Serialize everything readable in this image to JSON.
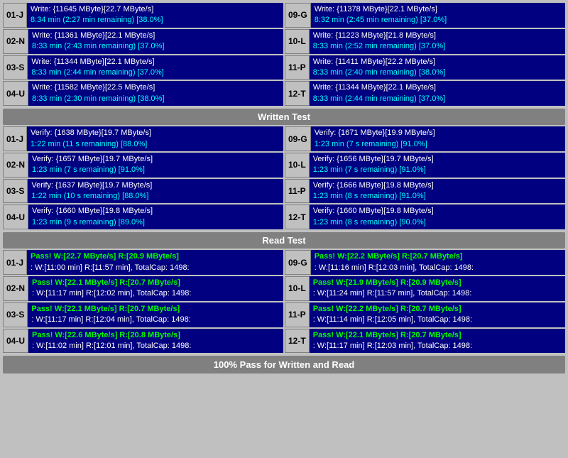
{
  "sections": {
    "write_test": {
      "label": "Written Test",
      "rows": [
        {
          "left": {
            "id": "01-J",
            "line1": "Write: {11645 MByte}[22.7 MByte/s]",
            "line2": "8:34 min (2:27 min remaining)  [38.0%]"
          },
          "right": {
            "id": "09-G",
            "line1": "Write: {11378 MByte}[22.1 MByte/s]",
            "line2": "8:32 min (2:45 min remaining)  [37.0%]"
          }
        },
        {
          "left": {
            "id": "02-N",
            "line1": "Write: {11361 MByte}[22.1 MByte/s]",
            "line2": "8:33 min (2:43 min remaining)  [37.0%]"
          },
          "right": {
            "id": "10-L",
            "line1": "Write: {11223 MByte}[21.8 MByte/s]",
            "line2": "8:33 min (2:52 min remaining)  [37.0%]"
          }
        },
        {
          "left": {
            "id": "03-S",
            "line1": "Write: {11344 MByte}[22.1 MByte/s]",
            "line2": "8:33 min (2:44 min remaining)  [37.0%]"
          },
          "right": {
            "id": "11-P",
            "line1": "Write: {11411 MByte}[22.2 MByte/s]",
            "line2": "8:33 min (2:40 min remaining)  [38.0%]"
          }
        },
        {
          "left": {
            "id": "04-U",
            "line1": "Write: {11582 MByte}[22.5 MByte/s]",
            "line2": "8:33 min (2:30 min remaining)  [38.0%]"
          },
          "right": {
            "id": "12-T",
            "line1": "Write: {11344 MByte}[22.1 MByte/s]",
            "line2": "8:33 min (2:44 min remaining)  [37.0%]"
          }
        }
      ]
    },
    "verify_test": {
      "rows": [
        {
          "left": {
            "id": "01-J",
            "line1": "Verify: {1638 MByte}[19.7 MByte/s]",
            "line2": "1:22 min (11 s remaining)  [88.0%]"
          },
          "right": {
            "id": "09-G",
            "line1": "Verify: {1671 MByte}[19.9 MByte/s]",
            "line2": "1:23 min (7 s remaining)  [91.0%]"
          }
        },
        {
          "left": {
            "id": "02-N",
            "line1": "Verify: {1657 MByte}[19.7 MByte/s]",
            "line2": "1:23 min (7 s remaining)  [91.0%]"
          },
          "right": {
            "id": "10-L",
            "line1": "Verify: {1656 MByte}[19.7 MByte/s]",
            "line2": "1:23 min (7 s remaining)  [91.0%]"
          }
        },
        {
          "left": {
            "id": "03-S",
            "line1": "Verify: {1637 MByte}[19.7 MByte/s]",
            "line2": "1:22 min (10 s remaining)  [88.0%]"
          },
          "right": {
            "id": "11-P",
            "line1": "Verify: {1666 MByte}[19.8 MByte/s]",
            "line2": "1:23 min (8 s remaining)  [91.0%]"
          }
        },
        {
          "left": {
            "id": "04-U",
            "line1": "Verify: {1660 MByte}[19.8 MByte/s]",
            "line2": "1:23 min (9 s remaining)  [89.0%]"
          },
          "right": {
            "id": "12-T",
            "line1": "Verify: {1660 MByte}[19.8 MByte/s]",
            "line2": "1:23 min (8 s remaining)  [90.0%]"
          }
        }
      ]
    },
    "read_test": {
      "label": "Read Test",
      "rows": [
        {
          "left": {
            "id": "01-J",
            "line1": "Pass! W:[22.7 MByte/s] R:[20.9 MByte/s]",
            "line2": ": W:[11:00 min] R:[11:57 min], TotalCap: 1498:"
          },
          "right": {
            "id": "09-G",
            "line1": "Pass! W:[22.2 MByte/s] R:[20.7 MByte/s]",
            "line2": ": W:[11:16 min] R:[12:03 min], TotalCap: 1498:"
          }
        },
        {
          "left": {
            "id": "02-N",
            "line1": "Pass! W:[22.1 MByte/s] R:[20.7 MByte/s]",
            "line2": ": W:[11:17 min] R:[12:02 min], TotalCap: 1498:"
          },
          "right": {
            "id": "10-L",
            "line1": "Pass! W:[21.9 MByte/s] R:[20.9 MByte/s]",
            "line2": ": W:[11:24 min] R:[11:57 min], TotalCap: 1498:"
          }
        },
        {
          "left": {
            "id": "03-S",
            "line1": "Pass! W:[22.1 MByte/s] R:[20.7 MByte/s]",
            "line2": ": W:[11:17 min] R:[12:04 min], TotalCap: 1498:"
          },
          "right": {
            "id": "11-P",
            "line1": "Pass! W:[22.2 MByte/s] R:[20.7 MByte/s]",
            "line2": ": W:[11:14 min] R:[12:05 min], TotalCap: 1498:"
          }
        },
        {
          "left": {
            "id": "04-U",
            "line1": "Pass! W:[22.6 MByte/s] R:[20.8 MByte/s]",
            "line2": ": W:[11:02 min] R:[12:01 min], TotalCap: 1498:"
          },
          "right": {
            "id": "12-T",
            "line1": "Pass! W:[22.1 MByte/s] R:[20.7 MByte/s]",
            "line2": ": W:[11:17 min] R:[12:03 min], TotalCap: 1498:"
          }
        }
      ]
    }
  },
  "headers": {
    "write_test": "Written Test",
    "read_test": "Read Test"
  },
  "footer": "100% Pass for Written and Read"
}
